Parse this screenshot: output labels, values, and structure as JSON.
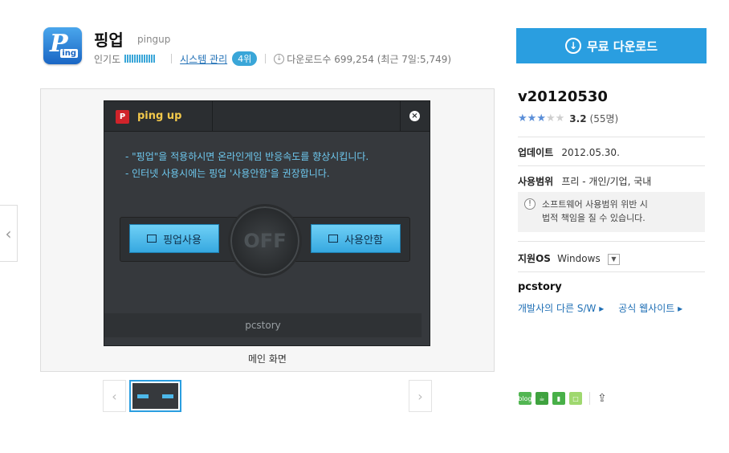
{
  "header": {
    "title": "핑업",
    "subtitle": "pingup",
    "popularity_label": "인기도",
    "category_link": "시스템 관리",
    "rank_badge": "4위",
    "downloads_text": "다운로드수 699,254 (최근 7일:5,749)"
  },
  "download_button": {
    "label": "무료 다운로드"
  },
  "viewer": {
    "caption": "메인 화면",
    "screenshot": {
      "app_title": "ping up",
      "notice_line1": "- \"핑업\"을 적용하시면 온라인게임 반응속도를 향상시킵니다.",
      "notice_line2": "-  인터넷 사용시에는  핑업 '사용안함'을 권장합니다.",
      "use_button": "핑업사용",
      "off_label": "OFF",
      "disable_button": "사용안함",
      "footer": "pcstory"
    }
  },
  "details": {
    "version": "v20120530",
    "rating_score": "3.2",
    "rating_count": "(55명)",
    "rating_stars_filled": 3,
    "update_label": "업데이트",
    "update_value": "2012.05.30.",
    "license_label": "사용범위",
    "license_value": "프리 - 개인/기업, 국내",
    "warning_line1": "소프트웨어 사용범위 위반 시",
    "warning_line2": "법적 책임을 질 수 있습니다.",
    "os_label": "지원OS",
    "os_value": "Windows",
    "developer": "pcstory",
    "dev_link1": "개발사의 다른 S/W",
    "dev_link2": "공식 웹사이트"
  },
  "colors": {
    "accent": "#2a9ee0",
    "link": "#1f6fb5",
    "star": "#5a8ed8"
  }
}
